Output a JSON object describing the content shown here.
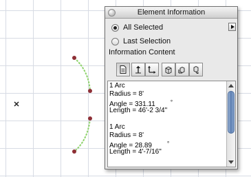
{
  "window": {
    "title": "Element Information"
  },
  "options": {
    "all_selected": "All Selected",
    "last_selection": "Last Selection"
  },
  "section": {
    "label": "Information Content"
  },
  "toolbar": {
    "icons": [
      "document-icon",
      "arrow-up-icon",
      "corner-arrows-icon",
      "cube-up-icon",
      "cube-corner-icon",
      "cube-rotate-icon"
    ]
  },
  "info": {
    "entries": [
      {
        "type": "1 Arc",
        "radius": "Radius = 8'",
        "angle": "Angle = 331.11",
        "degree": "°",
        "length": "Length = 46'-2 3/4\""
      },
      {
        "type": "1 Arc",
        "radius": "Radius = 8'",
        "angle": "Angle = 28.89",
        "degree": "°",
        "length": "Length = 4'-7/16\""
      }
    ]
  },
  "colors": {
    "arc": "#8fd36d",
    "node": "#8e2f36",
    "grid": "#d7dbe4"
  }
}
